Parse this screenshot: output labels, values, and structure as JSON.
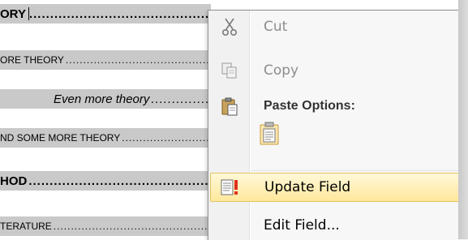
{
  "toc": [
    {
      "text": "ORY",
      "level": 1
    },
    {
      "text": "ORE THEORY",
      "level": 2
    },
    {
      "text": "Even more theory",
      "level": 3
    },
    {
      "text": "ND SOME MORE THEORY",
      "level": 2
    },
    {
      "text": "HOD",
      "level": 1
    },
    {
      "text": "TERATURE",
      "level": 2
    }
  ],
  "menu": {
    "cut": {
      "label": "Cut",
      "icon": "scissors-icon",
      "enabled": false
    },
    "copy": {
      "label": "Copy",
      "icon": "copy-icon",
      "enabled": false
    },
    "paste_options": {
      "label": "Paste Options:",
      "icon": "clipboard-icon"
    },
    "paste_keep_text": {
      "icon": "paste-keep-text-only-icon"
    },
    "update_field": {
      "label": "Update Field",
      "icon": "update-field-icon",
      "highlighted": true
    },
    "edit_field": {
      "label": "Edit Field...",
      "icon": "none"
    }
  },
  "colors": {
    "field_shading": "#c9c9c9",
    "highlight_top": "#fff8d9",
    "highlight_bottom": "#ffe89c",
    "highlight_border": "#e5c365",
    "disabled_text": "#8d8d8d"
  }
}
